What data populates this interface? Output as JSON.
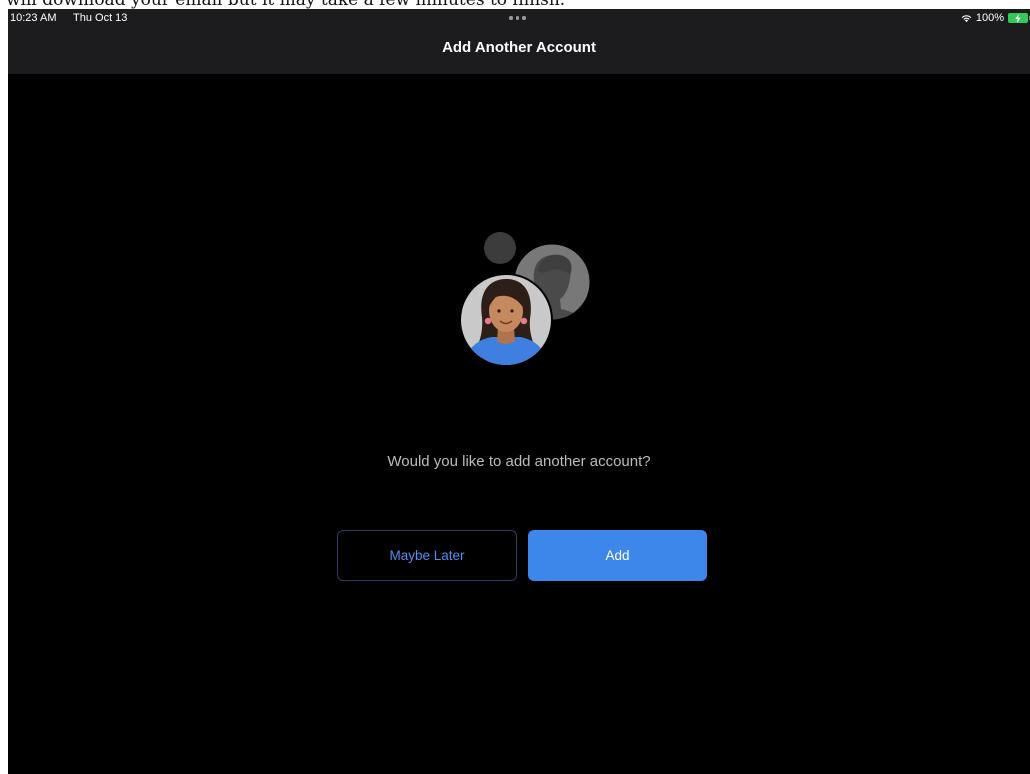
{
  "caption": {
    "text": "will download your email but it may take a few minutes to finish."
  },
  "status_bar": {
    "time": "10:23 AM",
    "date": "Thu Oct 13",
    "battery_percent": "100%",
    "icons": [
      "multitasking-dots-icon",
      "wifi-icon",
      "battery-charging-icon"
    ]
  },
  "nav": {
    "title": "Add Another Account"
  },
  "main": {
    "illustration": "account-avatars-illustration",
    "prompt": "Would you like to add another account?",
    "maybe_later_label": "Maybe Later",
    "add_label": "Add"
  },
  "colors": {
    "background": "#000000",
    "bar_background": "#1c1c1e",
    "accent": "#3e87ea",
    "secondary_text": "#bdbdbd",
    "battery": "#34c759"
  }
}
